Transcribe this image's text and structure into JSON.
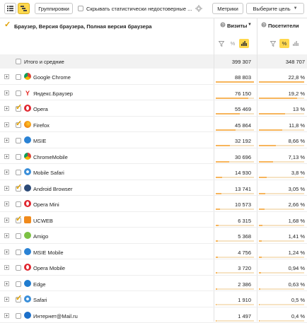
{
  "toolbar": {
    "group_label": "Группировки",
    "hide_stats_label": "Скрывать статистически недостоверные ...",
    "metrics_label": "Метрики",
    "goal_label": "Выберите цель"
  },
  "header": {
    "dimension_title": "Браузер, Версия браузера, Полная версия браузера",
    "visits_label": "Визиты",
    "visitors_label": "Посетители"
  },
  "totals": {
    "label": "Итого и средние",
    "visits": "399 307",
    "visitors": "348 707"
  },
  "colors": {
    "accent": "#ffd84d",
    "bar": "#f7b55b",
    "bar_track": "#f6e3c4",
    "tick": "#e0a000"
  },
  "rows": [
    {
      "name": "Google Chrome",
      "visits": "88 803",
      "visitors_pct": "22,8 %",
      "visits_frac": 1.0,
      "visitors_frac": 0.228,
      "checked": false,
      "icon": "chrome-icon"
    },
    {
      "name": "Яндекс.Браузер",
      "visits": "76 150",
      "visitors_pct": "19,2 %",
      "visits_frac": 0.857,
      "visitors_frac": 0.192,
      "checked": false,
      "icon": "yandex-browser-icon"
    },
    {
      "name": "Opera",
      "visits": "55 469",
      "visitors_pct": "13 %",
      "visits_frac": 0.625,
      "visitors_frac": 0.13,
      "checked": true,
      "icon": "opera-icon"
    },
    {
      "name": "Firefox",
      "visits": "45 864",
      "visitors_pct": "11,8 %",
      "visits_frac": 0.516,
      "visitors_frac": 0.118,
      "checked": true,
      "icon": "firefox-icon"
    },
    {
      "name": "MSIE",
      "visits": "32 192",
      "visitors_pct": "8,66 %",
      "visits_frac": 0.362,
      "visitors_frac": 0.0866,
      "checked": false,
      "icon": "msie-icon"
    },
    {
      "name": "ChromeMobile",
      "visits": "30 696",
      "visitors_pct": "7,13 %",
      "visits_frac": 0.346,
      "visitors_frac": 0.0713,
      "checked": false,
      "icon": "chrome-mobile-icon"
    },
    {
      "name": "Mobile Safari",
      "visits": "14 930",
      "visitors_pct": "3,8 %",
      "visits_frac": 0.168,
      "visitors_frac": 0.038,
      "checked": false,
      "icon": "mobile-safari-icon"
    },
    {
      "name": "Android Browser",
      "visits": "13 741",
      "visitors_pct": "3,05 %",
      "visits_frac": 0.155,
      "visitors_frac": 0.0305,
      "checked": true,
      "icon": "android-browser-icon"
    },
    {
      "name": "Opera Mini",
      "visits": "10 573",
      "visitors_pct": "2,66 %",
      "visits_frac": 0.119,
      "visitors_frac": 0.0266,
      "checked": false,
      "icon": "opera-mini-icon"
    },
    {
      "name": "UCWEB",
      "visits": "6 315",
      "visitors_pct": "1,68 %",
      "visits_frac": 0.071,
      "visitors_frac": 0.0168,
      "checked": true,
      "icon": "ucweb-icon"
    },
    {
      "name": "Amigo",
      "visits": "5 368",
      "visitors_pct": "1,41 %",
      "visits_frac": 0.06,
      "visitors_frac": 0.0141,
      "checked": false,
      "icon": "amigo-icon"
    },
    {
      "name": "MSIE Mobile",
      "visits": "4 756",
      "visitors_pct": "1,24 %",
      "visits_frac": 0.054,
      "visitors_frac": 0.0124,
      "checked": false,
      "icon": "msie-mobile-icon"
    },
    {
      "name": "Opera Mobile",
      "visits": "3 720",
      "visitors_pct": "0,94 %",
      "visits_frac": 0.042,
      "visitors_frac": 0.0094,
      "checked": false,
      "icon": "opera-mobile-icon"
    },
    {
      "name": "Edge",
      "visits": "2 386",
      "visitors_pct": "0,63 %",
      "visits_frac": 0.027,
      "visitors_frac": 0.0063,
      "checked": false,
      "icon": "edge-icon"
    },
    {
      "name": "Safari",
      "visits": "1 910",
      "visitors_pct": "0,5 %",
      "visits_frac": 0.022,
      "visitors_frac": 0.005,
      "checked": true,
      "icon": "safari-icon"
    },
    {
      "name": "Интернет@Mail.ru",
      "visits": "1 497",
      "visitors_pct": "0,4 %",
      "visits_frac": 0.017,
      "visitors_frac": 0.004,
      "checked": false,
      "icon": "mailru-icon"
    }
  ]
}
